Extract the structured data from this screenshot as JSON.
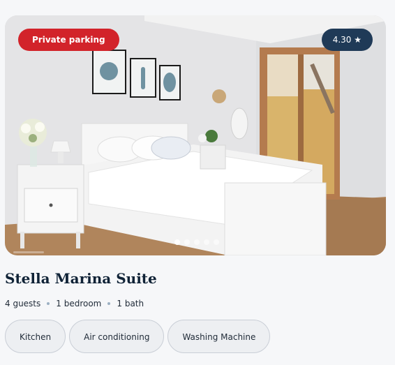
{
  "listing": {
    "badge": "Private parking",
    "rating": "4.30 ★",
    "title": "Stella Marina Suite",
    "meta": [
      "4 guests",
      "1 bedroom",
      "1 bath"
    ],
    "amenities": [
      "Kitchen",
      "Air conditioning",
      "Washing Machine"
    ],
    "carousel": {
      "total": 5,
      "active": 1
    }
  },
  "colors": {
    "accent_red": "#d2232a",
    "rating_bg": "#1f3a57",
    "title": "#0f2236"
  }
}
